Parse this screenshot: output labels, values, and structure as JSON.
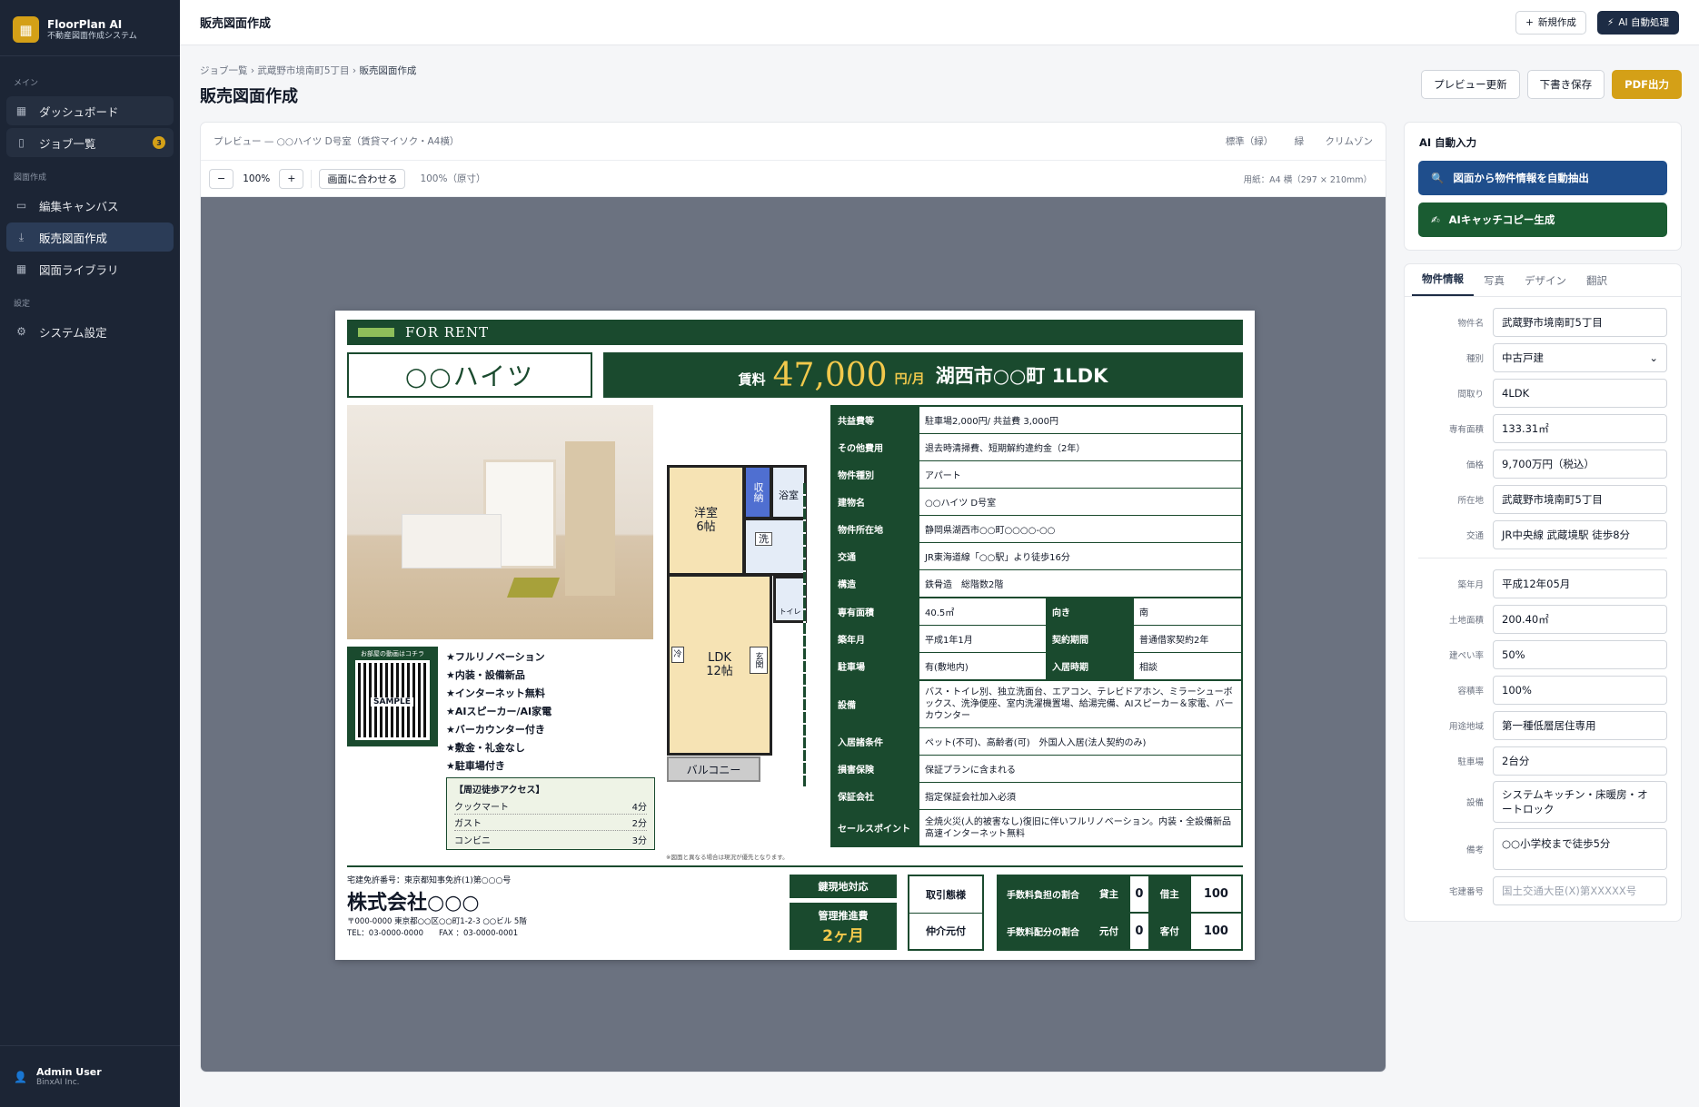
{
  "app": {
    "name": "FloorPlan AI",
    "subtitle": "不動産図面作成システム"
  },
  "sidebar": {
    "sections": [
      {
        "title": "メイン",
        "items": [
          {
            "label": "ダッシュボード",
            "icon": "grid-icon"
          },
          {
            "label": "ジョブ一覧",
            "icon": "file-icon",
            "badge": "3"
          }
        ]
      },
      {
        "title": "図面作成",
        "items": [
          {
            "label": "編集キャンバス",
            "icon": "monitor-icon"
          },
          {
            "label": "販売図面作成",
            "icon": "download-icon",
            "active": true
          },
          {
            "label": "図面ライブラリ",
            "icon": "grid-icon"
          }
        ]
      },
      {
        "title": "設定",
        "items": [
          {
            "label": "システム設定",
            "icon": "gear-icon"
          }
        ]
      }
    ],
    "user": {
      "name": "Admin User",
      "org": "BinxAI Inc."
    }
  },
  "topbar": {
    "title": "販売図面作成",
    "new_label": "新規作成",
    "ai_label": "AI 自動処理"
  },
  "breadcrumb": [
    "ジョブ一覧",
    "武蔵野市境南町5丁目",
    "販売図面作成"
  ],
  "page": {
    "title": "販売図面作成",
    "actions": {
      "preview": "プレビュー更新",
      "draft": "下書き保存",
      "pdf": "PDF出力"
    }
  },
  "preview": {
    "title": "プレビュー — ○○ハイツ D号室（賃貸マイソク・A4横）",
    "options": [
      "標準（緑）",
      "緑",
      "クリムゾン"
    ],
    "zoom": "100%",
    "fit_label": "画面に合わせる",
    "zoom_note": "100%（原寸）",
    "paper": "用紙：A4 横（297 × 210mm）"
  },
  "sheet": {
    "header": "FOR RENT",
    "name": "○○ハイツ",
    "rent": {
      "prefix": "賃料",
      "amount": "47,000",
      "unit": "円/月",
      "location": "湖西市○○町 1LDK"
    },
    "photo_alt": "室内写真",
    "qr": {
      "caption": "お部屋の動画はコチラ",
      "sample": "SAMPLE"
    },
    "features": [
      "★フルリノベーション",
      "★内装・設備新品",
      "★インターネット無料",
      "★AIスピーカー/AI家電",
      "★バーカウンター付き",
      "★敷金・礼金なし",
      "★駐車場付き"
    ],
    "access": {
      "title": "【周辺徒歩アクセス】",
      "items": [
        {
          "name": "クックマート",
          "time": "4分"
        },
        {
          "name": "ガスト",
          "time": "2分"
        },
        {
          "name": "コンビニ",
          "time": "3分"
        }
      ]
    },
    "plan": {
      "room1": "洋室",
      "room1_size": "6帖",
      "storage": "収納",
      "bath": "浴室",
      "wash": "洗",
      "toilet": "トイレ",
      "ldk": "LDK",
      "ldk_size": "12帖",
      "fridge": "冷",
      "entrance": "玄関",
      "balcony": "バルコニー"
    },
    "note": "※図面と異なる場合は現況が優先となります。",
    "specs": [
      {
        "k": "共益費等",
        "v": "駐車場2,000円/ 共益費 3,000円"
      },
      {
        "k": "その他費用",
        "v": "退去時清掃費、短期解約違約金（2年）"
      },
      {
        "k": "物件種別",
        "v": "アパート"
      },
      {
        "k": "建物名",
        "v": "○○ハイツ D号室"
      },
      {
        "k": "物件所在地",
        "v": "静岡県湖西市○○町○○○○-○○"
      },
      {
        "k": "交通",
        "v": "JR東海道線「○○駅」より徒歩16分"
      },
      {
        "k": "構造",
        "v": "鉄骨造　総階数2階"
      }
    ],
    "specs_split": [
      {
        "k": "専有面積",
        "v": "40.5㎡",
        "k2": "向き",
        "v2": "南"
      },
      {
        "k": "築年月",
        "v": "平成1年1月",
        "k2": "契約期間",
        "v2": "普通借家契約2年"
      },
      {
        "k": "駐車場",
        "v": "有(敷地内)",
        "k2": "入居時期",
        "v2": "相談"
      }
    ],
    "specs2": [
      {
        "k": "設備",
        "v": "バス・トイレ別、独立洗面台、エアコン、テレビドアホン、ミラーシューボックス、洗浄便座、室内洗濯機置場、給湯完備、AIスピーカー＆家電、バーカウンター"
      },
      {
        "k": "入居諸条件",
        "v": "ペット(不可)、高齢者(可)　外国人入居(法人契約のみ)"
      },
      {
        "k": "損害保険",
        "v": "保証プランに含まれる"
      },
      {
        "k": "保証会社",
        "v": "指定保証会社加入必須"
      },
      {
        "k": "セールスポイント",
        "v": "全焼火災(人的被害なし)復旧に伴いフルリノベーション。内装・全設備新品　高速インターネット無料"
      }
    ],
    "footer": {
      "license": "宅建免許番号：東京都知事免許(1)第○○○号",
      "company": "株式会社○○○",
      "address": "〒000-0000 東京都○○区○○町1-2-3 ○○ビル 5階",
      "tel": "TEL：03-0000-0000",
      "fax": "FAX ：03-0000-0001",
      "key_label": "鍵現地対応",
      "mgmt_label": "管理推進費",
      "mgmt_value": "2ヶ月",
      "deal_label": "取引態様",
      "deal_value": "仲介元付",
      "fee_burden": "手数料負担の割合",
      "fee_dist": "手数料配分の割合",
      "lender": "貸主",
      "lender_v": "0",
      "tenant": "借主",
      "tenant_v": "100",
      "origin": "元付",
      "origin_v": "0",
      "client": "客付",
      "client_v": "100"
    }
  },
  "ai": {
    "title": "AI 自動入力",
    "extract": "図面から物件情報を自動抽出",
    "catch": "AIキャッチコピー生成"
  },
  "form": {
    "tabs": [
      "物件情報",
      "写真",
      "デザイン",
      "翻訳"
    ],
    "fields": [
      {
        "label": "物件名",
        "value": "武蔵野市境南町5丁目"
      },
      {
        "label": "種別",
        "value": "中古戸建",
        "select": true
      },
      {
        "label": "間取り",
        "value": "4LDK"
      },
      {
        "label": "専有面積",
        "value": "133.31㎡"
      },
      {
        "label": "価格",
        "value": "9,700万円（税込）"
      },
      {
        "label": "所在地",
        "value": "武蔵野市境南町5丁目"
      },
      {
        "label": "交通",
        "value": "JR中央線 武蔵境駅 徒歩8分"
      }
    ],
    "fields2": [
      {
        "label": "築年月",
        "value": "平成12年05月"
      },
      {
        "label": "土地面積",
        "value": "200.40㎡"
      },
      {
        "label": "建ぺい率",
        "value": "50%"
      },
      {
        "label": "容積率",
        "value": "100%"
      },
      {
        "label": "用途地域",
        "value": "第一種低層居住専用"
      },
      {
        "label": "駐車場",
        "value": "2台分"
      },
      {
        "label": "設備",
        "value": "システムキッチン・床暖房・オートロック",
        "multi": true
      },
      {
        "label": "備考",
        "value": "○○小学校まで徒歩5分",
        "multi": true
      },
      {
        "label": "宅建番号",
        "value": "",
        "placeholder": "国土交通大臣(X)第XXXXX号"
      }
    ]
  },
  "colors": {
    "sidebar": "#1c2535",
    "accent": "#d4a017",
    "green": "#1a4a2e",
    "navy": "#1d2c45"
  }
}
